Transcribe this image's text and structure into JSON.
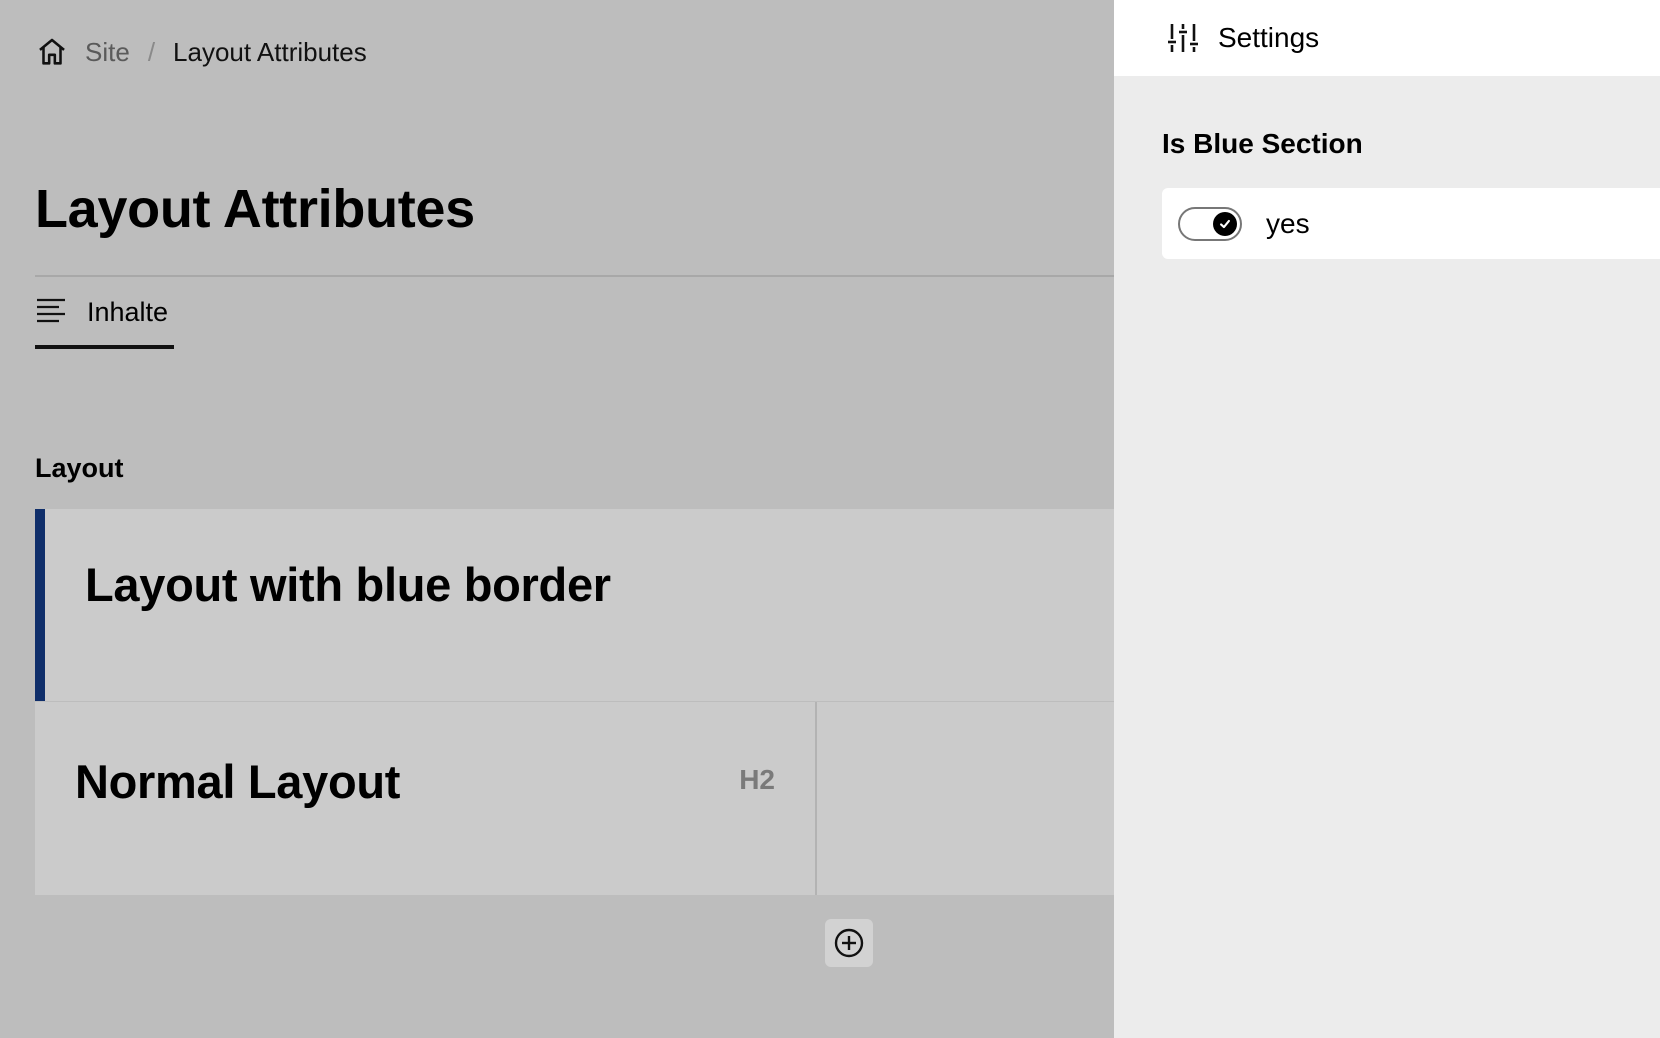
{
  "breadcrumb": {
    "root": "Site",
    "separator": "/",
    "current": "Layout Attributes"
  },
  "page": {
    "title": "Layout Attributes"
  },
  "tabs": [
    {
      "label": "Inhalte",
      "active": true
    }
  ],
  "section": {
    "label": "Layout"
  },
  "layouts": [
    {
      "heading": "Layout with blue border",
      "is_blue": true
    },
    {
      "heading": "Normal Layout",
      "badge": "H2",
      "is_blue": false
    }
  ],
  "drawer": {
    "title": "Settings",
    "field_label": "Is Blue Section",
    "toggle_text": "yes",
    "toggle_on": true
  },
  "colors": {
    "blue_border": "#0f2e6a",
    "overlay": "#bdbdbd",
    "drawer_bg": "#ececec"
  }
}
